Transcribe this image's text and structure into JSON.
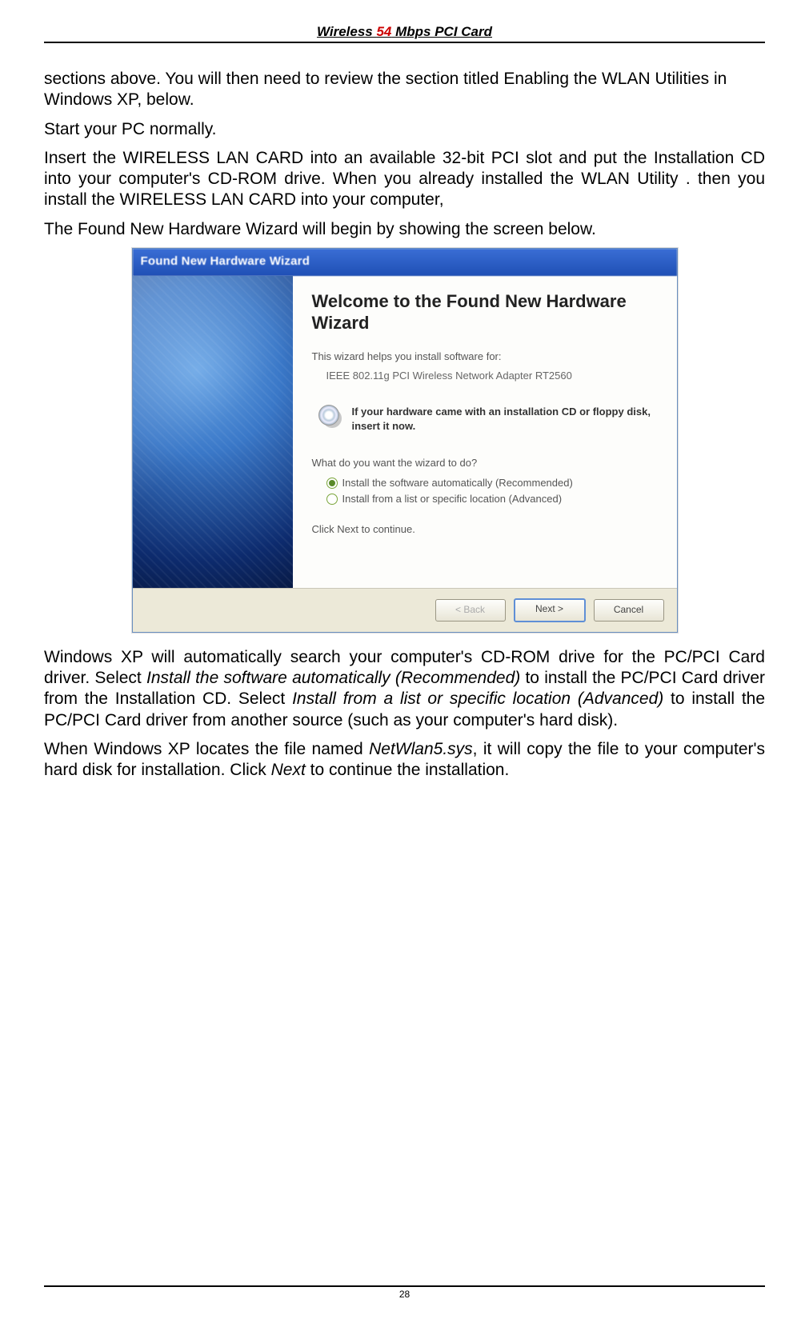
{
  "header": {
    "prefix": "Wireless ",
    "red": "54",
    "suffix": " Mbps PCI Card"
  },
  "paragraphs": {
    "p1": "sections above.  You will then need to review the section titled Enabling the WLAN Utilities in Windows XP, below.",
    "p2": "Start your PC normally.",
    "p3": "Insert the WIRELESS LAN CARD into an available 32-bit PCI slot and put the Installation CD into your computer's CD-ROM drive. When you already installed the WLAN Utility . then you install the WIRELESS LAN CARD into your computer,",
    "p4": "The Found New Hardware Wizard will begin by showing the screen below.",
    "p5a": "Windows XP will automatically search your computer's CD-ROM drive for the PC/PCI Card driver.  Select ",
    "p5b": "Install the software automatically (Recommended)",
    "p5c": " to install the PC/PCI Card driver from the Installation CD.  Select ",
    "p5d": "Install from a list or specific location (Advanced)",
    "p5e": " to install the PC/PCI Card driver from another source (such as your computer's hard disk).",
    "p6a": "When Windows XP locates the file named ",
    "p6b": "NetWlan5.sys",
    "p6c": ", it will copy the file to your computer's hard disk for installation.  Click ",
    "p6d": "Next",
    "p6e": " to continue the installation."
  },
  "wizard": {
    "titlebar": "Found New Hardware Wizard",
    "heading": "Welcome to the Found New Hardware Wizard",
    "helps": "This wizard helps you install software for:",
    "device": "IEEE 802.11g PCI Wireless Network Adapter RT2560",
    "cd_bold": "If your hardware came with an installation CD or floppy disk, insert it now.",
    "question": "What do you want the wizard to do?",
    "opt1": "Install the software automatically (Recommended)",
    "opt2": "Install from a list or specific location (Advanced)",
    "clicknext": "Click Next to continue.",
    "buttons": {
      "back": "< Back",
      "next": "Next >",
      "cancel": "Cancel"
    }
  },
  "footer": {
    "page": "28"
  }
}
